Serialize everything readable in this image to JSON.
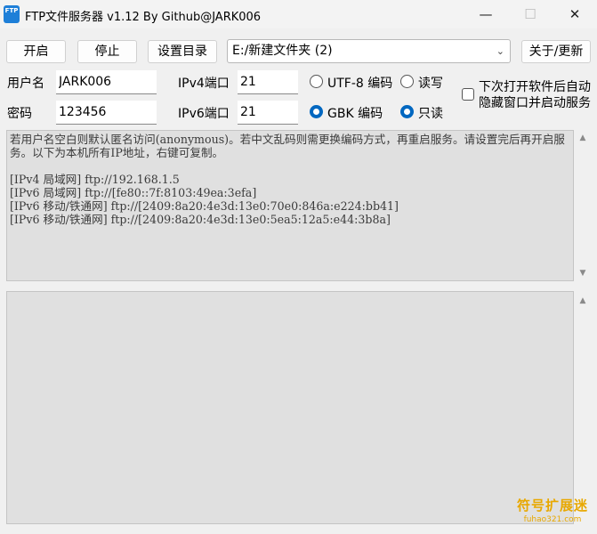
{
  "window": {
    "icon_text": "FTP",
    "title": "FTP文件服务器 v1.12 By Github@JARK006",
    "minimize": "—",
    "maximize": "☐",
    "close": "✕"
  },
  "toolbar": {
    "start_label": "开启",
    "stop_label": "停止",
    "set_dir_label": "设置目录",
    "directory_value": "E:/新建文件夹 (2)",
    "about_label": "关于/更新"
  },
  "form": {
    "username_label": "用户名",
    "username_value": "JARK006",
    "password_label": "密码",
    "password_value": "123456",
    "ipv4_port_label": "IPv4端口",
    "ipv4_port_value": "21",
    "ipv6_port_label": "IPv6端口",
    "ipv6_port_value": "21",
    "encoding_utf8_label": "UTF-8 编码",
    "encoding_gbk_label": "GBK 编码",
    "encoding_selected": "GBK",
    "access_rw_label": "读写",
    "access_ro_label": "只读",
    "access_selected": "只读",
    "auto_start_label_line1": "下次打开软件后自动",
    "auto_start_label_line2": "隐藏窗口并启动服务",
    "auto_start_checked": false
  },
  "info_log": {
    "text": "若用户名空白则默认匿名访问(anonymous)。若中文乱码则需更换编码方式，再重启服务。请设置完后再开启服务。以下为本机所有IP地址，右键可复制。\n\n[IPv4 局域网] ftp://192.168.1.5\n[IPv6 局域网] ftp://[fe80::7f:8103:49ea:3efa]\n[IPv6 移动/铁通网] ftp://[2409:8a20:4e3d:13e0:70e0:846a:e224:bb41]\n[IPv6 移动/铁通网] ftp://[2409:8a20:4e3d:13e0:5ea5:12a5:e44:3b8a]"
  },
  "watermark": {
    "line1": "符号扩展迷",
    "line2": "fuhao321.com"
  }
}
